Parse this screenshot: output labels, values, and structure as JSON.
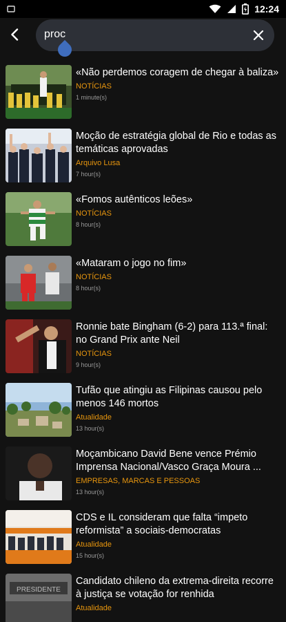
{
  "status": {
    "time": "12:24"
  },
  "search": {
    "query": "proc"
  },
  "articles": [
    {
      "title": "«Não perdemos coragem de chegar à baliza»",
      "category": "NOTÍCIAS",
      "time": "1 minute(s)",
      "thumb": "football-team"
    },
    {
      "title": "Moção de estratégia global de Rio e todas as temáticas aprovadas",
      "category": "Arquivo Lusa",
      "time": "7 hour(s)",
      "thumb": "congress-crowd"
    },
    {
      "title": "«Fomos autênticos leões»",
      "category": "NOTÍCIAS",
      "time": "8 hour(s)",
      "thumb": "football-player"
    },
    {
      "title": "«Mataram o jogo no fim»",
      "category": "NOTÍCIAS",
      "time": "8 hour(s)",
      "thumb": "football-match"
    },
    {
      "title": "Ronnie bate Bingham (6-2) para 113.ª final: no Grand Prix ante Neil",
      "category": "NOTÍCIAS",
      "time": "9 hour(s)",
      "thumb": "snooker-player"
    },
    {
      "title": "Tufão que atingiu as Filipinas causou pelo menos 146 mortos",
      "category": "Atualidade",
      "time": "13 hour(s)",
      "thumb": "typhoon-damage"
    },
    {
      "title": "Moçambicano David Bene vence Prémio Imprensa Nacional/Vasco Graça Moura ...",
      "category": "EMPRESAS, MARCAS E PESSOAS",
      "time": "13 hour(s)",
      "thumb": "portrait"
    },
    {
      "title": "CDS e IL consideram que falta “impeto reformista” a sociais-democratas",
      "category": "Atualidade",
      "time": "15 hour(s)",
      "thumb": "congress-stage"
    },
    {
      "title": "Candidato chileno da extrema-direita recorre à justiça se votação for renhida",
      "category": "Atualidade",
      "time": "",
      "thumb": "presidente-sign"
    }
  ]
}
